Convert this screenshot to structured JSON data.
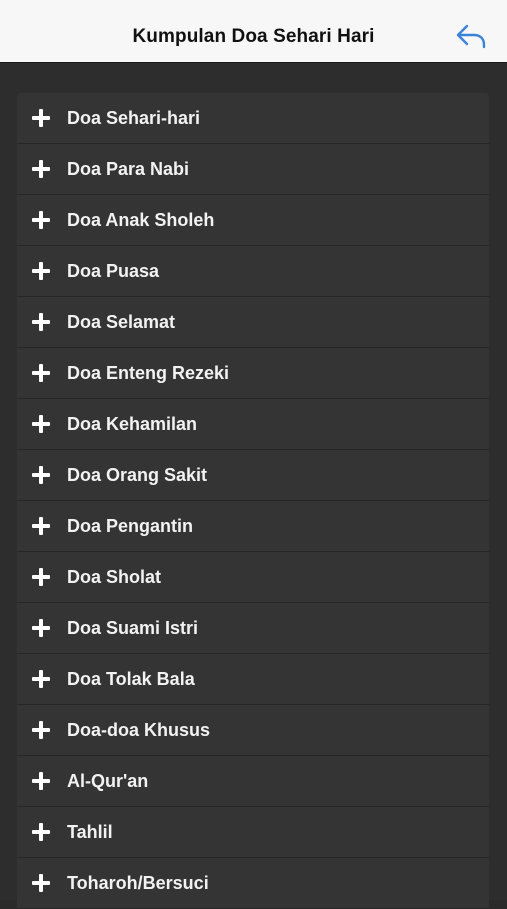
{
  "header": {
    "title": "Kumpulan Doa Sehari Hari",
    "back_icon": "reply-arrow-icon",
    "accent_color": "#3b82d9"
  },
  "list": {
    "icon": "plus-icon",
    "items": [
      {
        "label": "Doa Sehari-hari"
      },
      {
        "label": "Doa Para Nabi"
      },
      {
        "label": "Doa Anak Sholeh"
      },
      {
        "label": "Doa Puasa"
      },
      {
        "label": "Doa Selamat"
      },
      {
        "label": "Doa Enteng Rezeki"
      },
      {
        "label": "Doa Kehamilan"
      },
      {
        "label": "Doa Orang Sakit"
      },
      {
        "label": "Doa Pengantin"
      },
      {
        "label": "Doa Sholat"
      },
      {
        "label": "Doa Suami Istri"
      },
      {
        "label": "Doa Tolak Bala"
      },
      {
        "label": "Doa-doa Khusus"
      },
      {
        "label": "Al-Qur'an"
      },
      {
        "label": "Tahlil"
      },
      {
        "label": "Toharoh/Bersuci"
      }
    ]
  }
}
